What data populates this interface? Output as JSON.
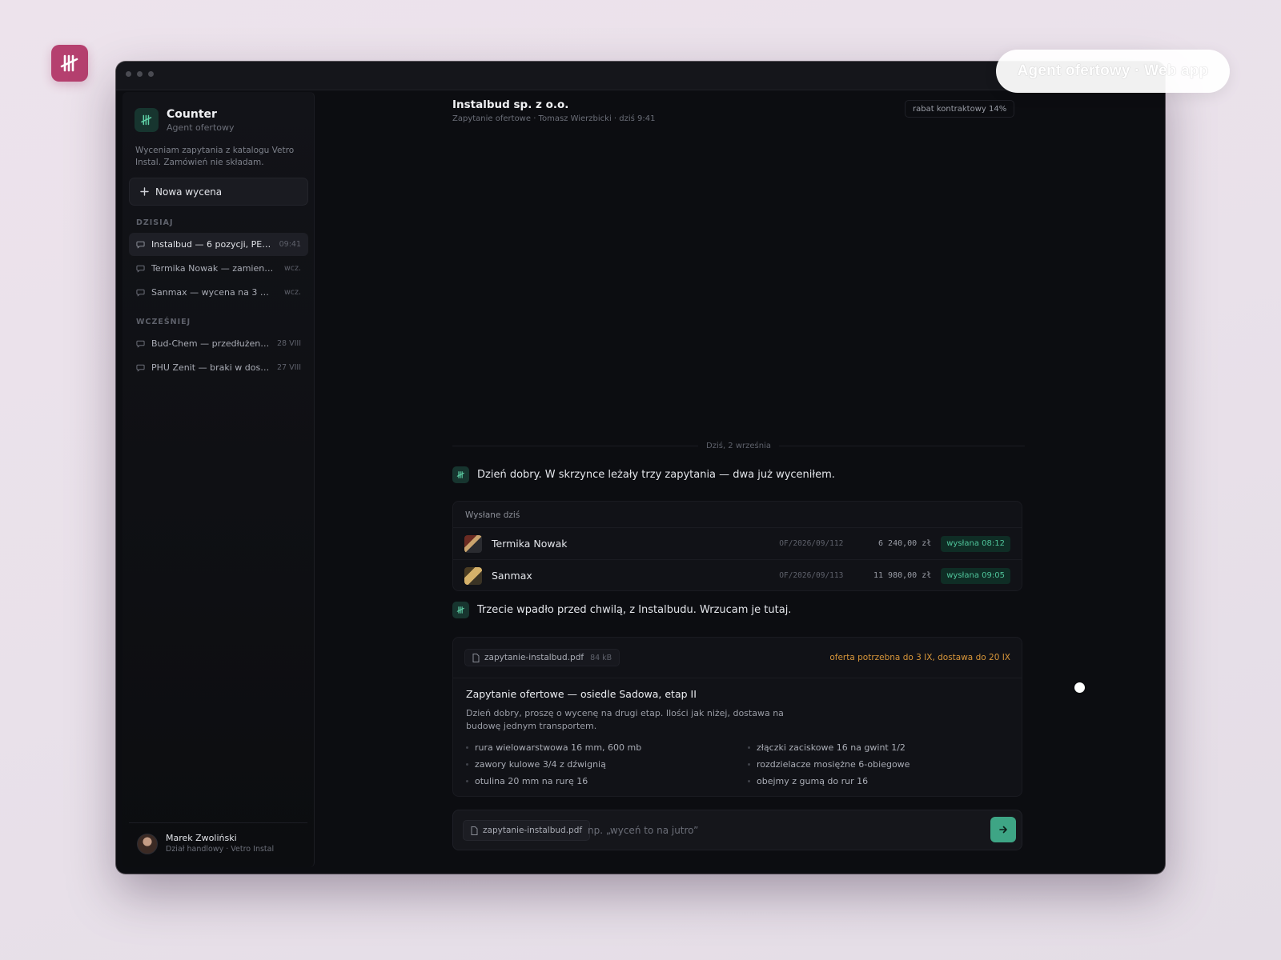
{
  "overlay": {
    "pill_label": "Agent ofertowy · Web app"
  },
  "app": {
    "name": "Counter",
    "subtitle": "Agent ofertowy",
    "intro": "Wyceniam zapytania z katalogu Vetro Instal. Zamówień nie składam."
  },
  "sidebar": {
    "new_button": "Nowa wycena",
    "sections": [
      {
        "label": "DZISIAJ",
        "items": [
          {
            "title": "Instalbud — 6 pozycji, PE…",
            "time": "09:41"
          },
          {
            "title": "Termika Nowak — zamien…",
            "time": "wcz."
          },
          {
            "title": "Sanmax — wycena na 3 …",
            "time": "wcz."
          }
        ]
      },
      {
        "label": "WCZEŚNIEJ",
        "items": [
          {
            "title": "Bud-Chem — przedłużen…",
            "time": "28 VIII"
          },
          {
            "title": "PHU Zenit — braki w dos…",
            "time": "27 VIII"
          }
        ]
      }
    ],
    "user": {
      "name": "Marek Zwoliński",
      "role": "Dział handlowy · Vetro Instal"
    }
  },
  "chat": {
    "title": "Instalbud sp. z o.o.",
    "subtitle": "Zapytanie ofertowe · Tomasz Wierzbicki · dziś 9:41",
    "discount_badge": "rabat kontraktowy 14%",
    "date_separator": "Dziś, 2 września",
    "message_1": "Dzień dobry. W skrzynce leżały trzy zapytania — dwa już wyceniłem.",
    "sent_today": {
      "title": "Wysłane dziś",
      "rows": [
        {
          "client": "Termika Nowak",
          "ref": "OF/2026/09/112",
          "amount": "6 240,00 zł",
          "status": "wysłana 08:12"
        },
        {
          "client": "Sanmax",
          "ref": "OF/2026/09/113",
          "amount": "11 980,00 zł",
          "status": "wysłana 09:05"
        }
      ]
    },
    "message_2": "Trzecie wpadło przed chwilą, z Instalbudu. Wrzucam je tutaj.",
    "document": {
      "file_name": "zapytanie-instalbud.pdf",
      "file_size": "84 kB",
      "deadline": "oferta potrzebna do 3 IX, dostawa do 20 IX",
      "title": "Zapytanie ofertowe — osiedle Sadowa, etap II",
      "body": "Dzień dobry, proszę o wycenę na drugi etap. Ilości jak niżej, dostawa na budowę jednym transportem.",
      "items": [
        "rura wielowarstwowa 16 mm, 600 mb",
        "złączki zaciskowe 16 na gwint 1/2",
        "zawory kulowe 3/4 z dźwignią",
        "rozdzielacze mosiężne 6-obiegowe",
        "otulina 20 mm na rurę 16",
        "obejmy z gumą do rur 16"
      ]
    },
    "composer": {
      "attachment": "zapytanie-instalbud.pdf",
      "placeholder": "np. „wyceń to na jutro”"
    }
  },
  "colors": {
    "accent": "#3ea585",
    "brand": "#b5406f",
    "warning": "#d8963a"
  }
}
